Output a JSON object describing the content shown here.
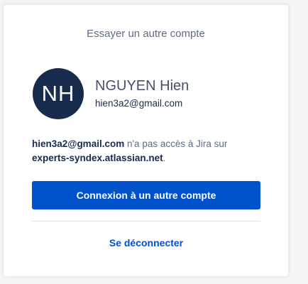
{
  "card": {
    "heading": "Essayer un autre compte"
  },
  "user": {
    "initials": "NH",
    "name": "NGUYEN Hien",
    "email": "hien3a2@gmail.com"
  },
  "message": {
    "email": "hien3a2@gmail.com",
    "text_before_site": " n'a pas accès à Jira sur",
    "site": "experts-syndex.atlassian.net",
    "text_end": "."
  },
  "actions": {
    "primary_label": "Connexion à un autre compte",
    "logout_label": "Se déconnecter"
  },
  "colors": {
    "primary": "#0052cc",
    "avatar_bg": "#172b4d",
    "muted_text": "#5e6c84"
  }
}
